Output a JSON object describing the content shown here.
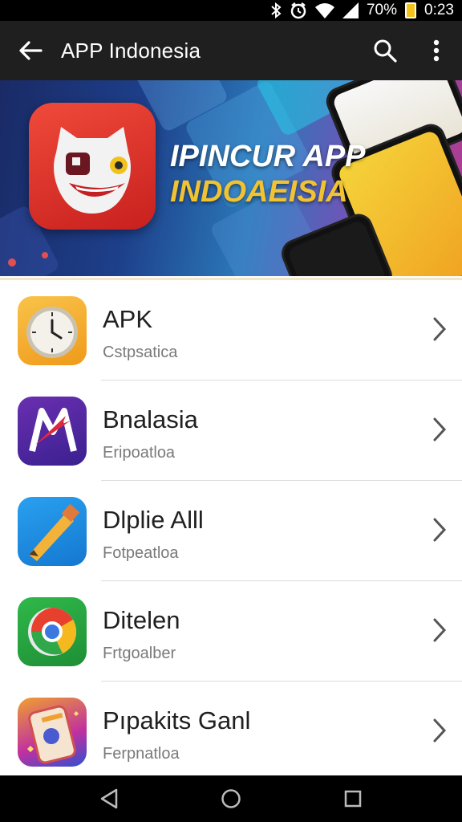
{
  "status_bar": {
    "battery_percent": "70%",
    "time": "0:23",
    "icons": [
      "bluetooth-icon",
      "alarm-icon",
      "wifi-icon",
      "signal-icon",
      "battery-icon"
    ]
  },
  "app_bar": {
    "title": "APP Indonesia",
    "icons": [
      "back-arrow-icon",
      "search-icon",
      "more-vert-icon"
    ]
  },
  "banner": {
    "line1": "IPINCUR APP",
    "line2": "INDOAEISIA",
    "colors": {
      "line1": "#ffffff",
      "line2": "#f1c232",
      "logo": "#e0352a"
    }
  },
  "apps": [
    {
      "name": "APK",
      "subtitle": "Cstpsatica",
      "icon": "clock-app-icon"
    },
    {
      "name": "Bnalasia",
      "subtitle": "Eripoatloa",
      "icon": "m-logo-app-icon"
    },
    {
      "name": "Dlplie Alll",
      "subtitle": "Fotpeatloa",
      "icon": "pencil-app-icon"
    },
    {
      "name": "Ditelen",
      "subtitle": "Frtgoalber",
      "icon": "chrome-app-icon"
    },
    {
      "name": "Pıpakits Ganl",
      "subtitle": "Ferpnatloa",
      "icon": "phone-app-icon"
    }
  ],
  "nav_bar": {
    "icons": [
      "back-triangle-icon",
      "home-circle-icon",
      "recents-square-icon"
    ]
  }
}
